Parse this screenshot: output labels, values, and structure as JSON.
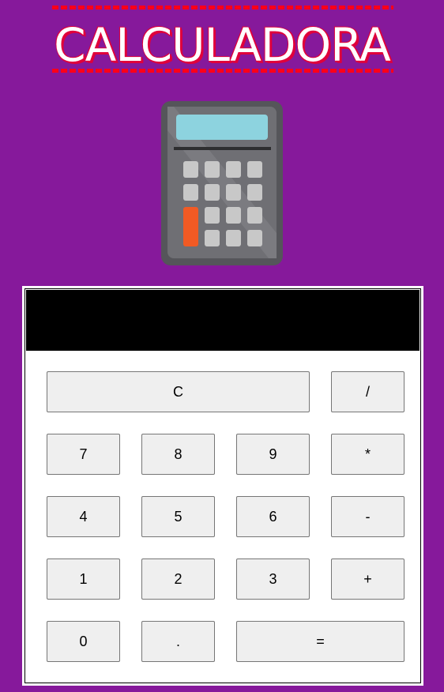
{
  "header": {
    "title": "CALCULADORA"
  },
  "logo": {
    "icon": "calculator-icon",
    "colors": {
      "body": "#5a5a5e",
      "screen": "#8dd3df",
      "key": "#c8c8c8",
      "accent_key": "#f15a24"
    }
  },
  "display": {
    "value": ""
  },
  "keys": {
    "clear": "C",
    "divide": "/",
    "seven": "7",
    "eight": "8",
    "nine": "9",
    "multiply": "*",
    "four": "4",
    "five": "5",
    "six": "6",
    "minus": "-",
    "one": "1",
    "two": "2",
    "three": "3",
    "plus": "+",
    "zero": "0",
    "dot": ".",
    "equals": "="
  },
  "colors": {
    "page_background": "#86199b",
    "title_shadow": "#e0003b",
    "display_background": "#000000",
    "key_background": "#efefef"
  }
}
